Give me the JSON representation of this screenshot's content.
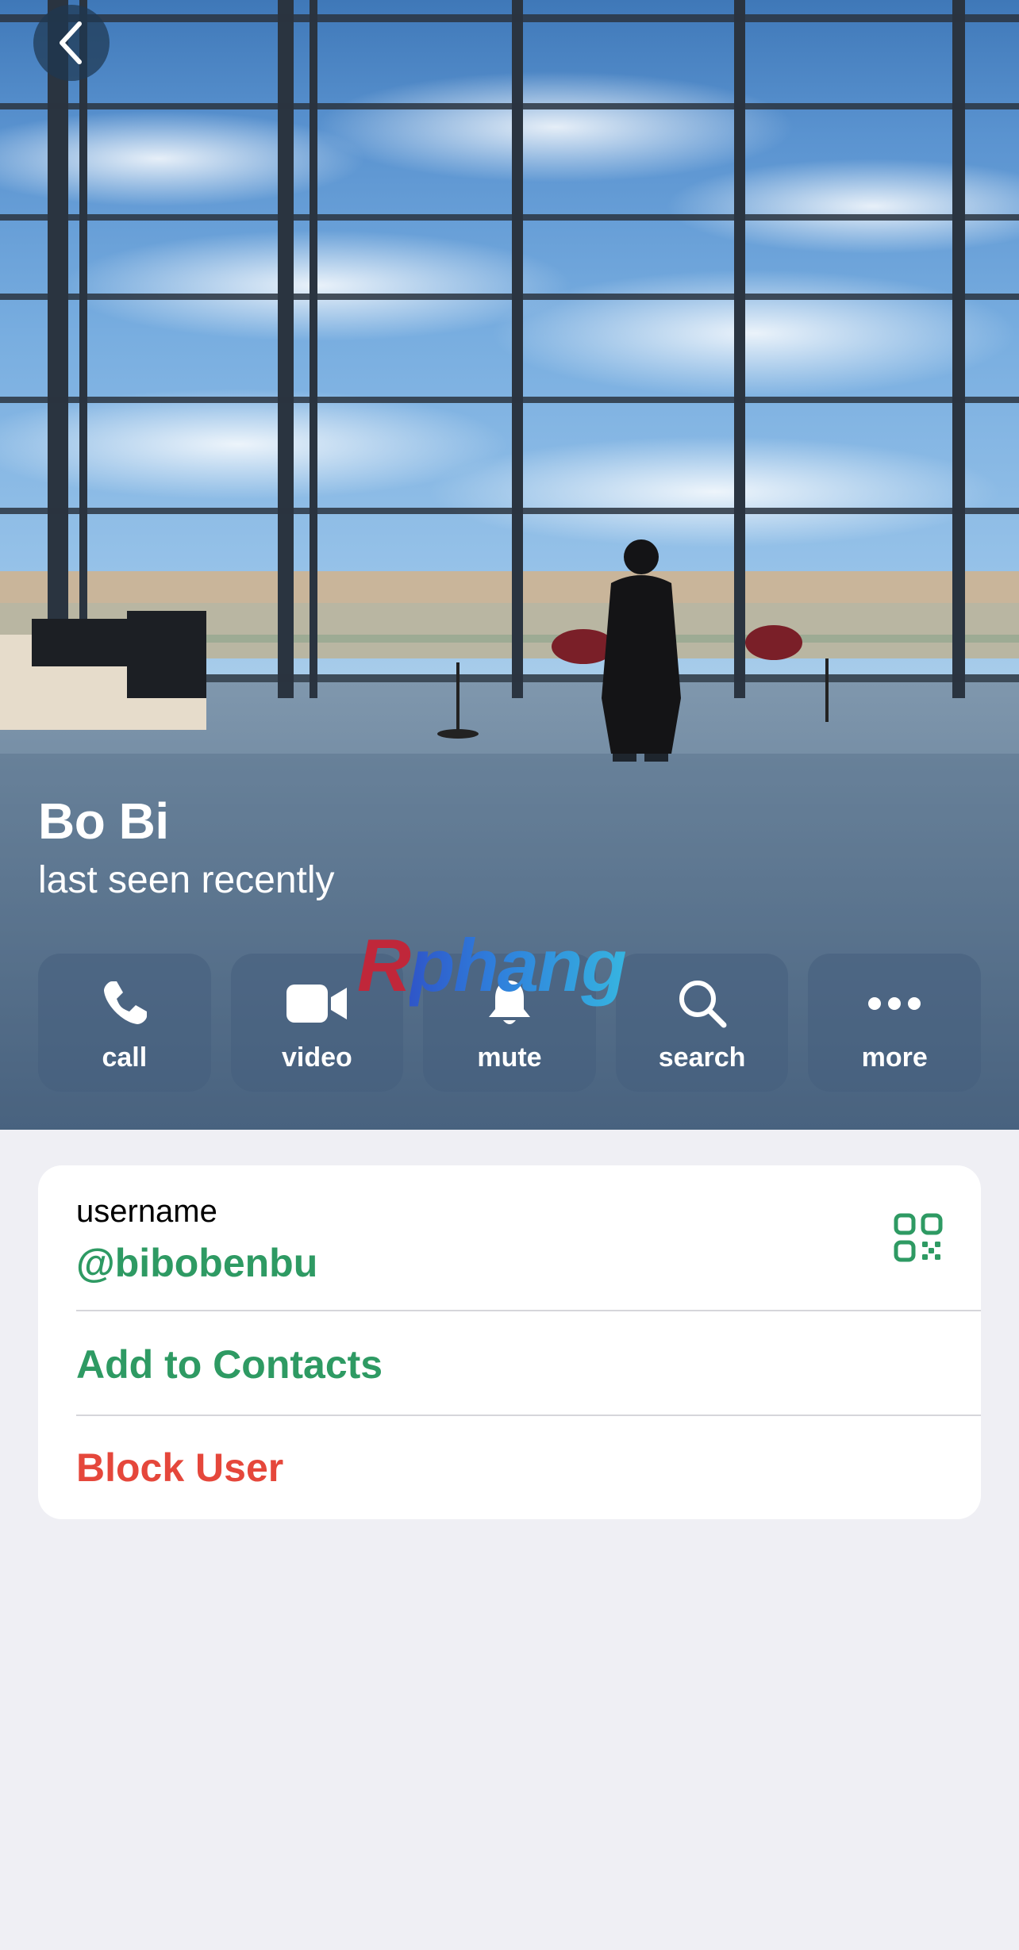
{
  "profile": {
    "name": "Bo Bi",
    "status": "last seen recently"
  },
  "actions": [
    {
      "label": "call",
      "icon": "phone-icon"
    },
    {
      "label": "video",
      "icon": "video-camera-icon"
    },
    {
      "label": "mute",
      "icon": "bell-icon"
    },
    {
      "label": "search",
      "icon": "search-icon"
    },
    {
      "label": "more",
      "icon": "more-dots-icon"
    }
  ],
  "watermark": {
    "first": "R",
    "rest": "phang"
  },
  "info": {
    "username_label": "username",
    "username_value": "@bibobenbu",
    "add_contact": "Add to Contacts",
    "block_user": "Block User"
  },
  "colors": {
    "accent_green": "#2e9a63",
    "danger_red": "#e5473b",
    "background": "#efeff4"
  }
}
